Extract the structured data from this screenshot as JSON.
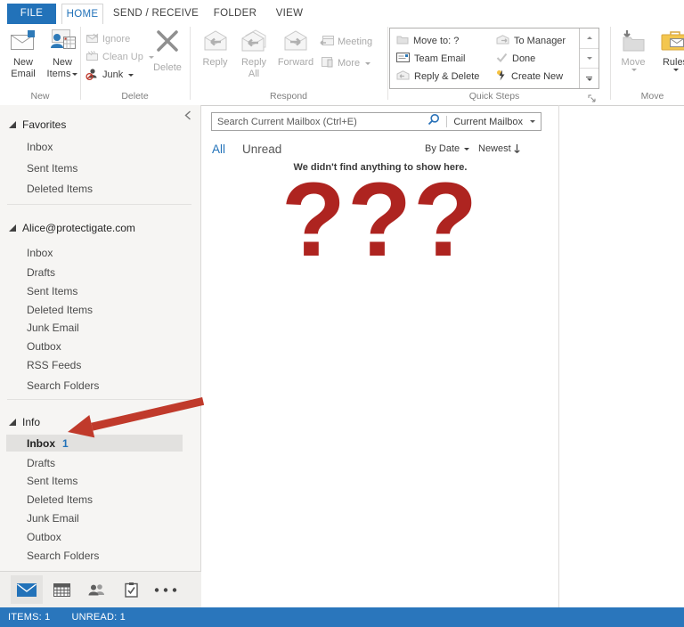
{
  "window": {
    "tabs": [
      {
        "label": "FILE"
      },
      {
        "label": "HOME"
      },
      {
        "label": "SEND / RECEIVE"
      },
      {
        "label": "FOLDER"
      },
      {
        "label": "VIEW"
      }
    ]
  },
  "ribbon": {
    "new_group": {
      "label": "New",
      "new_email": {
        "line1": "New",
        "line2": "Email"
      },
      "new_items": {
        "line1": "New",
        "line2": "Items"
      }
    },
    "delete_group": {
      "label": "Delete",
      "ignore": "Ignore",
      "clean_up": "Clean Up",
      "junk": "Junk",
      "delete": "Delete"
    },
    "respond_group": {
      "label": "Respond",
      "reply": "Reply",
      "reply_all_line1": "Reply",
      "reply_all_line2": "All",
      "forward": "Forward",
      "meeting": "Meeting",
      "more": "More"
    },
    "quick_steps_group": {
      "label": "Quick Steps",
      "items": [
        {
          "label": "Move to: ?",
          "enabled": false
        },
        {
          "label": "Team Email",
          "enabled": true
        },
        {
          "label": "Reply & Delete",
          "enabled": false
        },
        {
          "label": "To Manager",
          "enabled": false
        },
        {
          "label": "Done",
          "enabled": false
        },
        {
          "label": "Create New",
          "enabled": true
        }
      ]
    },
    "move_group": {
      "label": "Move",
      "move": "Move",
      "rules": "Rules"
    }
  },
  "search": {
    "placeholder": "Search Current Mailbox (Ctrl+E)",
    "scope": "Current Mailbox"
  },
  "list_header": {
    "all": "All",
    "unread": "Unread",
    "sort": "By Date",
    "order": "Newest"
  },
  "empty_state": {
    "message": "We didn't find anything to show here.",
    "overlay": "???"
  },
  "sidebar": {
    "sections": [
      {
        "header": "Favorites",
        "items": [
          {
            "label": "Inbox"
          },
          {
            "label": "Sent Items"
          },
          {
            "label": "Deleted Items"
          }
        ]
      },
      {
        "header": "Alice@protectigate.com",
        "items": [
          {
            "label": "Inbox"
          },
          {
            "label": "Drafts"
          },
          {
            "label": "Sent Items"
          },
          {
            "label": "Deleted Items"
          },
          {
            "label": "Junk Email"
          },
          {
            "label": "Outbox"
          },
          {
            "label": "RSS Feeds"
          },
          {
            "label": "Search Folders"
          }
        ]
      },
      {
        "header": "Info",
        "items": [
          {
            "label": "Inbox",
            "count": "1",
            "selected": true
          },
          {
            "label": "Drafts"
          },
          {
            "label": "Sent Items"
          },
          {
            "label": "Deleted Items"
          },
          {
            "label": "Junk Email"
          },
          {
            "label": "Outbox"
          },
          {
            "label": "Search Folders"
          }
        ]
      }
    ]
  },
  "status_bar": {
    "items": "ITEMS: 1",
    "unread": "UNREAD: 1"
  },
  "colors": {
    "tab_blue": "#2272b9",
    "status_bar_blue": "#2a76bc",
    "arrow_red": "#c03a2b",
    "question_red": "#ae2420"
  }
}
